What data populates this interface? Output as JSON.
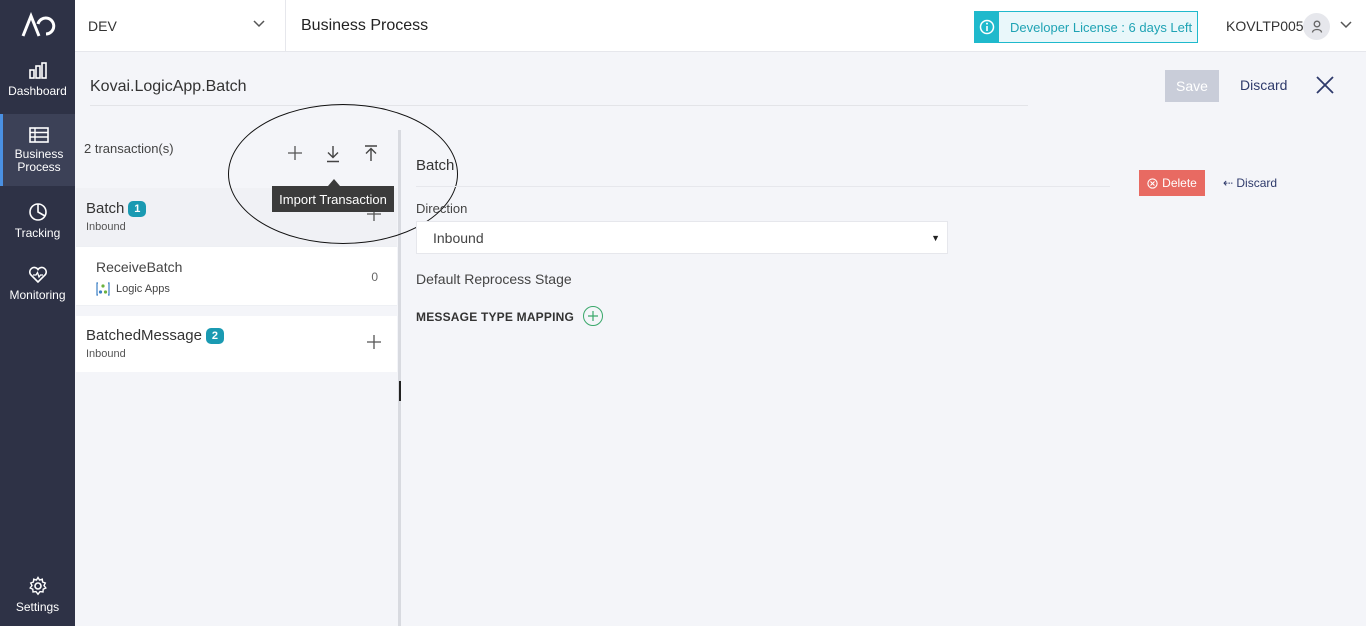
{
  "sidebar": {
    "items": [
      {
        "label": "Dashboard"
      },
      {
        "label": "Business Process"
      },
      {
        "label": "Tracking"
      },
      {
        "label": "Monitoring"
      },
      {
        "label": "Settings"
      }
    ]
  },
  "topbar": {
    "environment": "DEV",
    "title": "Business Process",
    "license": "Developer License : 6 days Left",
    "user": "KOVLTP005"
  },
  "header": {
    "record_name": "Kovai.LogicApp.Batch",
    "save_label": "Save",
    "discard_label": "Discard"
  },
  "transactions": {
    "count_label": "2 transaction(s)",
    "tooltip": "Import Transaction",
    "groups": [
      {
        "name": "Batch",
        "badge": "1",
        "direction": "Inbound",
        "items": [
          {
            "name": "ReceiveBatch",
            "type": "Logic Apps",
            "count": "0"
          }
        ]
      },
      {
        "name": "BatchedMessage",
        "badge": "2",
        "direction": "Inbound",
        "items": []
      }
    ]
  },
  "detail": {
    "section_title": "Batch",
    "delete_label": "Delete",
    "discard_label": "Discard",
    "direction_label": "Direction",
    "direction_value": "Inbound",
    "reprocess_label": "Default Reprocess Stage",
    "mapping_label": "MESSAGE TYPE MAPPING"
  },
  "colors": {
    "sidebar": "#2e3246",
    "accent": "#1fb9cc",
    "badge": "#1a9ab2",
    "delete": "#e86a62",
    "add_green": "#3aa86b"
  }
}
